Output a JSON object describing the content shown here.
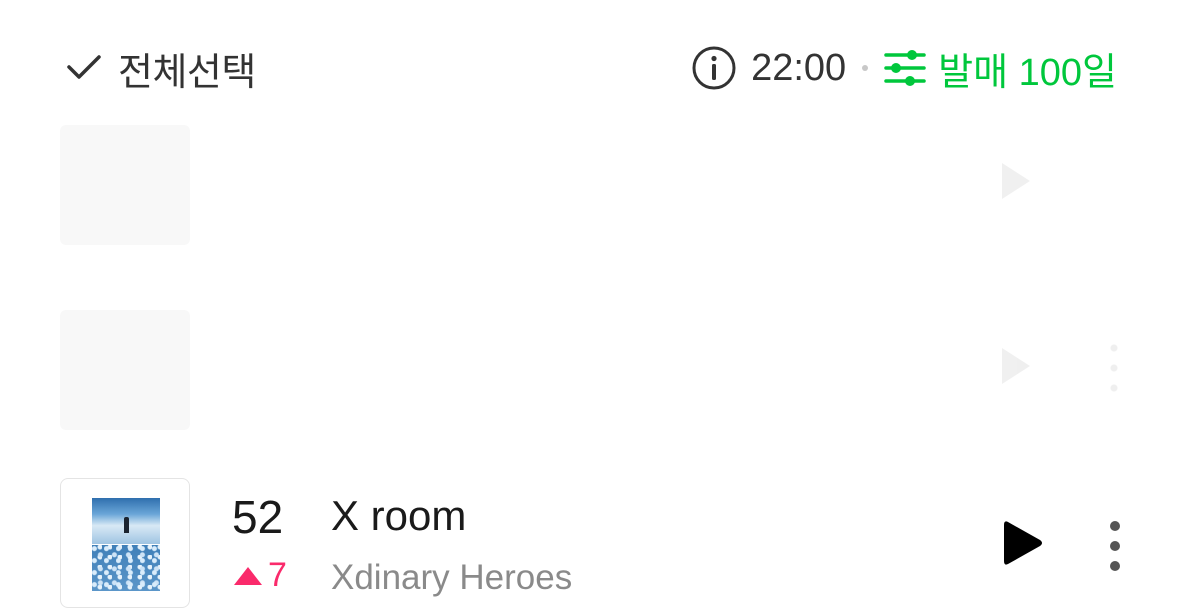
{
  "header": {
    "select_all_label": "전체선택",
    "time": "22:00",
    "filter_label": "발매 100일",
    "accent_color": "#00c73c"
  },
  "rows": [
    {
      "rank": "52",
      "change": "7",
      "change_direction": "up",
      "title": "X room",
      "artist": "Xdinary Heroes"
    }
  ],
  "colors": {
    "rank_up": "#fa2a6b",
    "artist_text": "#8a8a8a"
  },
  "icons": {
    "check": "check-icon",
    "info": "info-icon",
    "filter": "sliders-icon",
    "play": "play-icon",
    "more": "more-vertical-icon",
    "rank_up": "triangle-up-icon"
  }
}
